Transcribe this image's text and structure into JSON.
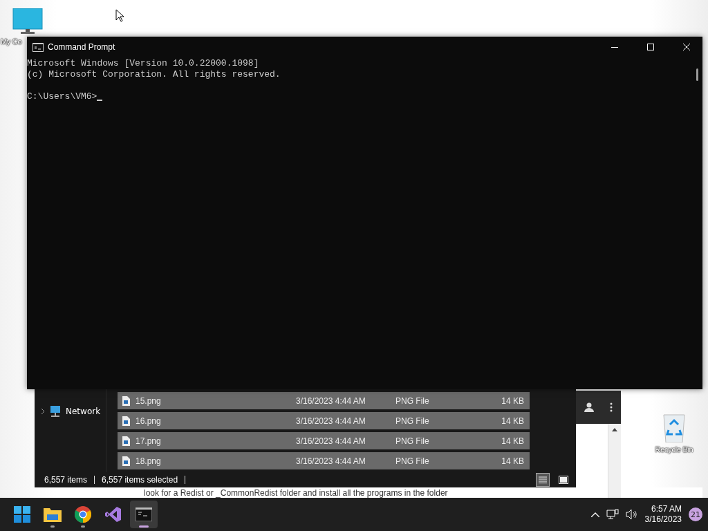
{
  "desktop_icons": [
    {
      "kind": "computer",
      "label": "My Co"
    },
    {
      "kind": "recycle",
      "label": "Recycle Bin"
    }
  ],
  "browser_page": {
    "text": "look for a Redist or _CommonRedist folder and install all the programs in the folder"
  },
  "explorer": {
    "nav_items": [
      {
        "label": "Network"
      }
    ],
    "files": [
      {
        "name": "15.png",
        "date": "3/16/2023 4:44 AM",
        "type": "PNG File",
        "size": "14 KB",
        "selected": true
      },
      {
        "name": "16.png",
        "date": "3/16/2023 4:44 AM",
        "type": "PNG File",
        "size": "14 KB",
        "selected": true
      },
      {
        "name": "17.png",
        "date": "3/16/2023 4:44 AM",
        "type": "PNG File",
        "size": "14 KB",
        "selected": true
      },
      {
        "name": "18.png",
        "date": "3/16/2023 4:44 AM",
        "type": "PNG File",
        "size": "14 KB",
        "selected": true
      }
    ],
    "status": {
      "count": "6,557 items",
      "selected": "6,557 items selected"
    },
    "views": [
      {
        "kind": "details",
        "selected": true
      },
      {
        "kind": "tiles",
        "selected": false
      }
    ]
  },
  "cmd_window": {
    "title": "Command Prompt",
    "lines": [
      "Microsoft Windows [Version 10.0.22000.1098]",
      "(c) Microsoft Corporation. All rights reserved."
    ],
    "prompt": "C:\\Users\\VM6>"
  },
  "taskbar": {
    "apps": [
      {
        "kind": "start",
        "running": false,
        "active": false
      },
      {
        "kind": "explorer",
        "running": true,
        "active": false
      },
      {
        "kind": "chrome",
        "running": true,
        "active": false
      },
      {
        "kind": "vs",
        "running": false,
        "active": false
      },
      {
        "kind": "cmd",
        "running": true,
        "active": true
      }
    ],
    "time": "6:57 AM",
    "date": "3/16/2023",
    "notifications": "21"
  }
}
